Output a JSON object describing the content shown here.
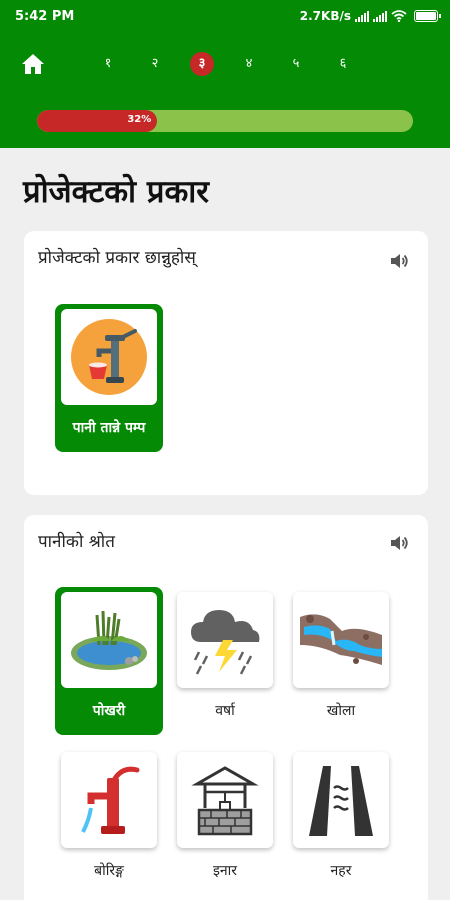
{
  "status_bar": {
    "time": "5:42 PM",
    "speed": "2.7KB/s",
    "signal_icon": "signal-icon",
    "wifi_icon": "wifi-icon",
    "battery_icon": "battery-icon"
  },
  "header": {
    "home_icon": "home-icon",
    "steps": [
      "१",
      "२",
      "३",
      "४",
      "५",
      "६"
    ],
    "active_step": "३",
    "progress_percent": 32,
    "progress_label": "32%",
    "colors": {
      "header": "#058a05",
      "accent": "#c62828",
      "track": "#8bc34a"
    }
  },
  "page": {
    "title": "प्रोजेक्टको प्रकार"
  },
  "section_project_type": {
    "title": "प्रोजेक्टको प्रकार छान्नुहोस्",
    "speaker_icon": "speaker-icon",
    "options": [
      {
        "label": "पानी तान्ने पम्प",
        "icon": "hand-pump-icon",
        "selected": true
      }
    ]
  },
  "section_water_source": {
    "title": "पानीको श्रोत",
    "speaker_icon": "speaker-icon",
    "options": [
      {
        "label": "पोखरी",
        "icon": "pond-icon",
        "selected": true
      },
      {
        "label": "वर्षा",
        "icon": "rain-cloud-icon",
        "selected": false
      },
      {
        "label": "खोला",
        "icon": "river-icon",
        "selected": false
      },
      {
        "label": "बोरिङ्ग",
        "icon": "water-pump-icon",
        "selected": false
      },
      {
        "label": "इनार",
        "icon": "well-icon",
        "selected": false
      },
      {
        "label": "नहर",
        "icon": "canal-icon",
        "selected": false
      }
    ]
  }
}
